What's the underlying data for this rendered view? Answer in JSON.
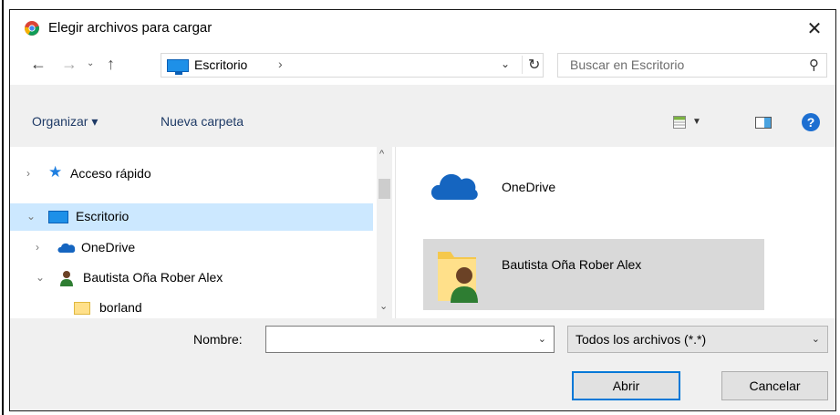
{
  "window": {
    "title": "Elegir archivos para cargar",
    "close_glyph": "✕"
  },
  "nav": {
    "back_glyph": "←",
    "forward_glyph": "→",
    "recent_glyph": "⌄",
    "up_glyph": "↑"
  },
  "address": {
    "location": "Escritorio",
    "separator": "›",
    "dropdown_glyph": "⌄",
    "refresh_glyph": "↻"
  },
  "search": {
    "placeholder": "Buscar en Escritorio",
    "icon_glyph": "⚲"
  },
  "toolbar": {
    "organize_label": "Organizar ▾",
    "new_folder_label": "Nueva carpeta",
    "view_dd_glyph": "▼",
    "help_glyph": "?"
  },
  "tree": {
    "items": [
      {
        "label": "Acceso rápido",
        "chevron": "›"
      },
      {
        "label": "Escritorio",
        "chevron": "⌄"
      },
      {
        "label": "OneDrive",
        "chevron": "›"
      },
      {
        "label": "Bautista Oña Rober Alex",
        "chevron": "⌄"
      },
      {
        "label": "borland",
        "chevron": ""
      }
    ]
  },
  "files": {
    "items": [
      {
        "label": "OneDrive",
        "icon": "cloud-icon"
      },
      {
        "label": "Bautista Oña Rober Alex",
        "icon": "user-folder-icon"
      }
    ]
  },
  "footer": {
    "filename_label": "Nombre:",
    "filename_value": "",
    "dropdown_glyph": "⌄",
    "filetype_value": "Todos los archivos (*.*)",
    "open_label": "Abrir",
    "cancel_label": "Cancelar"
  },
  "scroll": {
    "up_glyph": "^",
    "down_glyph": "⌄"
  },
  "colors": {
    "accent": "#0078d7",
    "selected_row": "#cce8ff",
    "hover_item": "#d9d9d9"
  }
}
